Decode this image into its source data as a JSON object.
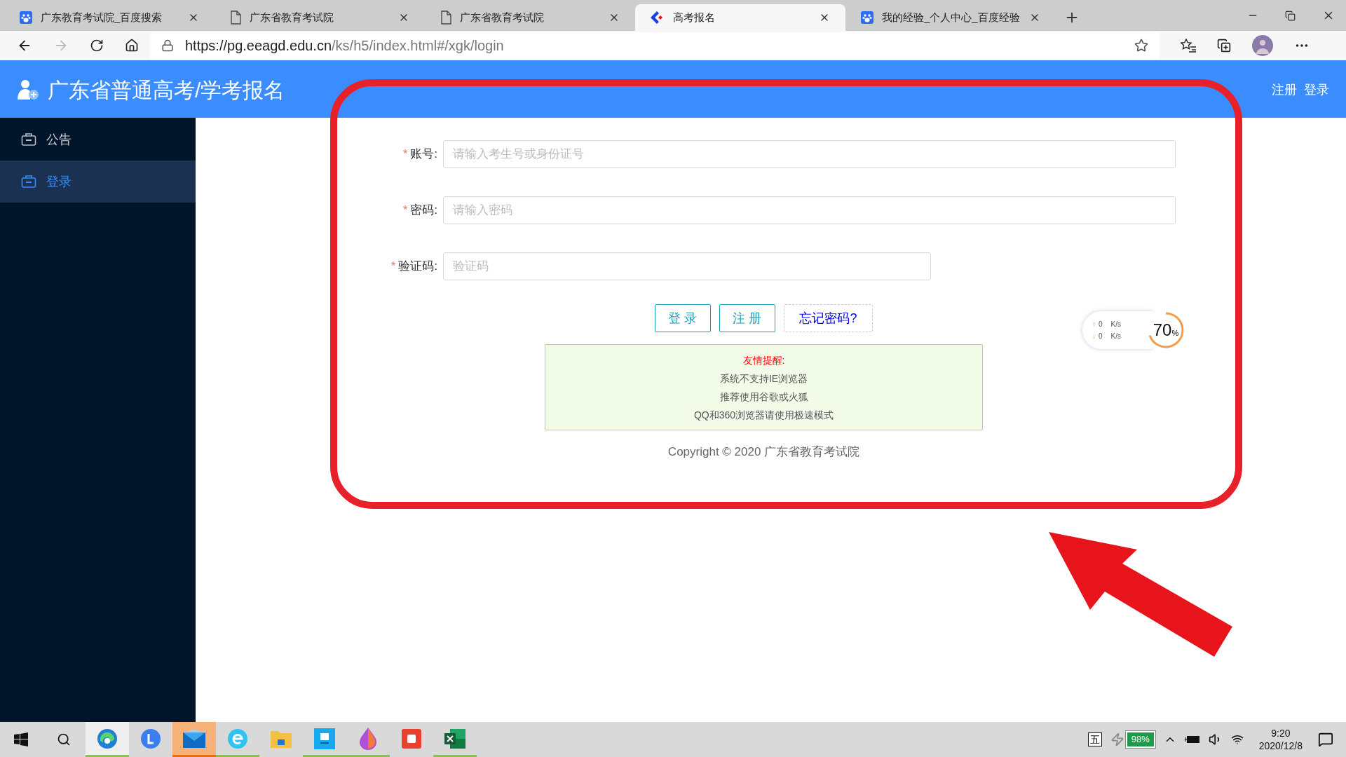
{
  "browser": {
    "tabs": [
      {
        "kind": "baidu",
        "title": "广东教育考试院_百度搜索",
        "selected": false
      },
      {
        "kind": "page",
        "title": "广东省教育考试院",
        "selected": false
      },
      {
        "kind": "page",
        "title": "广东省教育考试院",
        "selected": false
      },
      {
        "kind": "site",
        "title": "高考报名",
        "selected": true
      },
      {
        "kind": "baidu",
        "title": "我的经验_个人中心_百度经验",
        "selected": false
      }
    ],
    "url_host": "https://pg.eeagd.edu.cn",
    "url_path": "/ks/h5/index.html#/xgk/login"
  },
  "header": {
    "title": "广东省普通高考/学考报名",
    "links": [
      "注册",
      "登录"
    ]
  },
  "sidebar": {
    "items": [
      {
        "label": "公告",
        "selected": false
      },
      {
        "label": "登录",
        "selected": true
      }
    ]
  },
  "form": {
    "required_mark": "*",
    "fields": [
      {
        "label": "账号:",
        "required": true,
        "placeholder": "请输入考生号或身份证号",
        "kind": "wide"
      },
      {
        "label": "密码:",
        "required": true,
        "placeholder": "请输入密码",
        "kind": "wide"
      },
      {
        "label": "验证码:",
        "required": true,
        "placeholder": "验证码",
        "kind": "short"
      }
    ],
    "buttons": [
      {
        "label": "登 录",
        "kind": "outline"
      },
      {
        "label": "注 册",
        "kind": "outline"
      },
      {
        "label": "忘记密码?",
        "kind": "dashed"
      }
    ],
    "notice": {
      "title": "友情提醒:",
      "lines": [
        "系统不支持IE浏览器",
        "推荐使用谷歌或火狐",
        "QQ和360浏览器请使用极速模式"
      ]
    },
    "copyright": "Copyright © 2020 广东省教育考试院"
  },
  "speed_widget": {
    "up_arrow": "↑",
    "down_arrow": "↓",
    "up": "0",
    "up_unit": "K/s",
    "down": "0",
    "down_unit": "K/s",
    "percent": "70",
    "percent_sign": "%"
  },
  "taskbar": {
    "apps": [
      {
        "kind": "edge",
        "running": true,
        "selected": true,
        "flashing": false
      },
      {
        "kind": "l-app",
        "running": false,
        "selected": false,
        "flashing": false
      },
      {
        "kind": "mail",
        "running": false,
        "selected": false,
        "flashing": true
      },
      {
        "kind": "e-app",
        "running": true,
        "selected": false,
        "flashing": false
      },
      {
        "kind": "folder",
        "running": false,
        "selected": false,
        "flashing": false
      },
      {
        "kind": "square-app",
        "running": true,
        "selected": false,
        "flashing": false
      },
      {
        "kind": "drop",
        "running": true,
        "selected": false,
        "flashing": false
      },
      {
        "kind": "red-app",
        "running": false,
        "selected": false,
        "flashing": false
      },
      {
        "kind": "excel",
        "running": true,
        "selected": false,
        "flashing": false
      }
    ],
    "ime": "五",
    "battery": "98%",
    "time": "9:20",
    "date": "2020/12/8"
  }
}
